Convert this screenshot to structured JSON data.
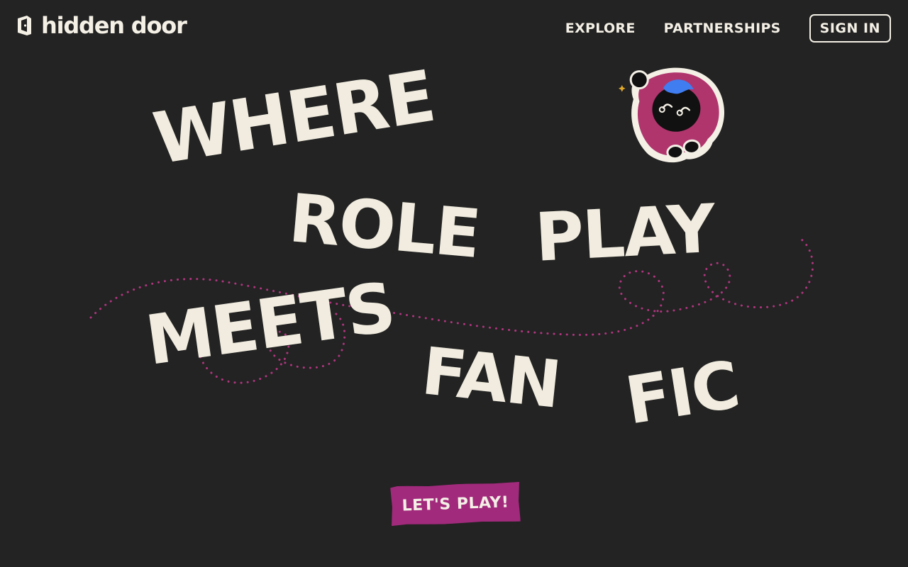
{
  "header": {
    "logo_text": "hidden door",
    "nav": {
      "explore": "EXPLORE",
      "partnerships": "PARTNERSHIPS",
      "sign_in": "SIGN IN"
    }
  },
  "hero": {
    "words": {
      "where": "WHERE",
      "role": "ROLE",
      "play": "PLAY",
      "meets": "MEETS",
      "fan": "FAN",
      "fic": "FIC"
    },
    "cta": "LET'S PLAY!"
  },
  "icons": {
    "logo": "door-logo-icon",
    "mascot": "hooded-character-icon",
    "sparkle": "sparkle-icon"
  },
  "colors": {
    "background": "#232323",
    "text": "#f1ecdf",
    "accent": "#a12a7c",
    "dots": "#b0357f",
    "hood": "#b0356d",
    "hair": "#3f7df0"
  }
}
